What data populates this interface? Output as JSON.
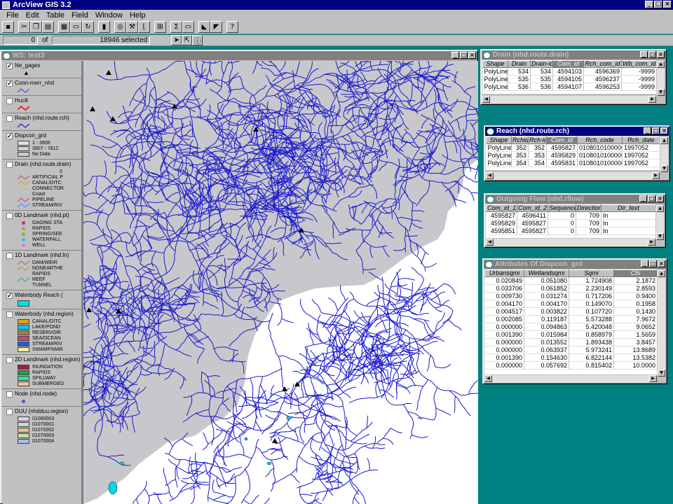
{
  "app": {
    "title": "ArcView GIS 3.2"
  },
  "menu": [
    "File",
    "Edit",
    "Table",
    "Field",
    "Window",
    "Help"
  ],
  "status": {
    "count": "0",
    "of": "of",
    "selected": "18946 selected"
  },
  "ws": {
    "title": "WS: test3"
  },
  "toc": {
    "ne_gages": "Ne_gages",
    "conn": "Conn-merr_nhd",
    "huc8": "Huc8",
    "reach": "Reach (nhd.route.rch)",
    "dispcon": "Dispcon_grd",
    "dispcon_legend": [
      "1 - 3906",
      "3907 - 7812",
      "No Data"
    ],
    "drain": "Drain (nhd.route.drain)",
    "drain_zero": "0",
    "drain_legend": [
      "ARTIFICIAL P",
      "CANAL/DITC",
      "CONNECTOR",
      "Coast",
      "PIPELINE",
      "STREAM/RIV"
    ],
    "lm0": "0D Landmark (nhd.pt)",
    "lm0_legend": [
      "GAGING STA",
      "RAPIDS",
      "SPRING/SEE",
      "WATERFALL",
      "WELL"
    ],
    "lm1": "1D Landmark (nhd.ln)",
    "lm1_legend": [
      "DAM/WEIR",
      "NONEARTHE",
      "RAPIDS",
      "REEF",
      "TUNNEL"
    ],
    "wbreach": "Waterbody Reach (",
    "wb": "Waterbody (nhd.region)",
    "wb_legend": [
      "CANAL/DITC",
      "LAKE/POND",
      "RESERVOIR",
      "SEA/OCEAN",
      "STREAM/RIV",
      "SWAMP/MAR"
    ],
    "lm2": "2D Landmark (nhd.region)",
    "lm2_legend": [
      "INUNDATION",
      "RAPIDS",
      "SPILLWAY",
      "SUBMERGED"
    ],
    "node": "Node (nhd.node)",
    "duu": "DUU (nhdduu.region)",
    "duu_legend": [
      "01060003",
      "01070001",
      "01070002",
      "01070003",
      "01070004"
    ]
  },
  "drain_table": {
    "title": "Drain (nhd.route.drain)",
    "headers": [
      "Shape",
      "Drain",
      "Drain-id",
      "Com_id",
      "Rch_com_id",
      "Wb_com_id"
    ],
    "rows": [
      [
        "PolyLine",
        "534",
        "534",
        "4594103",
        "4596369",
        "-9999"
      ],
      [
        "PolyLine",
        "535",
        "535",
        "4594105",
        "4596237",
        "-9999"
      ],
      [
        "PolyLine",
        "536",
        "536",
        "4594107",
        "4596253",
        "-9999"
      ]
    ]
  },
  "reach_table": {
    "title": "Reach (nhd.route.rch)",
    "headers": [
      "Shape",
      "Rchid",
      "Rch-id",
      "Com_id",
      "Rch_code",
      "Rch_date"
    ],
    "rows": [
      [
        "PolyLine",
        "352",
        "352",
        "4595827",
        "01080101000004",
        "1997052"
      ],
      [
        "PolyLine",
        "353",
        "353",
        "4595829",
        "01080101000005",
        "1997052"
      ],
      [
        "PolyLine",
        "354",
        "354",
        "4595831",
        "01080101000006",
        "1997052"
      ]
    ]
  },
  "flow_table": {
    "title": "Outgoing Flow (nhd.rflow)",
    "headers": [
      "Com_id_1",
      "Com_id_2",
      "Sequence",
      "Direction",
      "Dir_text"
    ],
    "rows": [
      [
        "4595827",
        "4596411",
        "0",
        "709",
        "In"
      ],
      [
        "4595829",
        "4595827",
        "0",
        "709",
        "In"
      ],
      [
        "4595851",
        "4595827",
        "0",
        "709",
        "In"
      ]
    ]
  },
  "attr_table": {
    "title": "Attributes Of Dispcon_grd",
    "headers": [
      "Urbansqmi",
      "Wetlandsqmi",
      "Sqmi",
      "Cfs"
    ],
    "rows": [
      [
        "0.020849",
        "0.051080",
        "1.724908",
        "2.1872"
      ],
      [
        "0.033706",
        "0.061852",
        "2.230149",
        "2.8593"
      ],
      [
        "0.009730",
        "0.031274",
        "0.717206",
        "0.9400"
      ],
      [
        "0.004170",
        "0.004170",
        "0.149070",
        "0.1958"
      ],
      [
        "0.004517",
        "0.003822",
        "0.107720",
        "0.1430"
      ],
      [
        "0.002085",
        "0.119187",
        "5.573288",
        "7.9672"
      ],
      [
        "0.000000",
        "0.094863",
        "5.420048",
        "9.0652"
      ],
      [
        "0.001390",
        "0.015984",
        "0.858979",
        "1.5659"
      ],
      [
        "0.000000",
        "0.013552",
        "1.893438",
        "3.8457"
      ],
      [
        "0.000000",
        "0.063937",
        "5.973241",
        "13.8689"
      ],
      [
        "0.001390",
        "0.154630",
        "6.822144",
        "13.5382"
      ],
      [
        "0.000000",
        "0.057692",
        "0.815402",
        "10.0000"
      ]
    ]
  },
  "colors": {
    "river": "#1a1acc",
    "shade": "#c8c8cc",
    "desktop": "#008080",
    "titlebar": "#000080"
  }
}
